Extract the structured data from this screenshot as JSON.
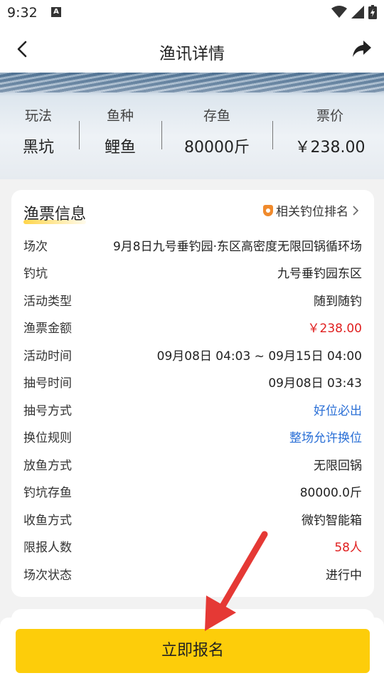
{
  "status_bar": {
    "time": "9:32",
    "a_icon": "A"
  },
  "nav": {
    "title": "渔讯详情"
  },
  "hero": {
    "stats": [
      {
        "label": "玩法",
        "value": "黑坑"
      },
      {
        "label": "鱼种",
        "value": "鲤鱼"
      },
      {
        "label": "存鱼",
        "value": "80000斤"
      },
      {
        "label": "票价",
        "value": "￥238.00"
      }
    ]
  },
  "card": {
    "title": "渔票信息",
    "rank_link": "相关钓位排名",
    "rows": [
      {
        "label": "场次",
        "value": "9月8日九号垂钓园·东区高密度无限回锅循环场"
      },
      {
        "label": "钓坑",
        "value": "九号垂钓园东区"
      },
      {
        "label": "活动类型",
        "value": "随到随钓"
      },
      {
        "label": "渔票金额",
        "value": "￥238.00",
        "color": "red"
      },
      {
        "label": "活动时间",
        "value": "09月08日 04:03 ~ 09月15日 04:00"
      },
      {
        "label": "抽号时间",
        "value": "09月08日 03:43"
      },
      {
        "label": "抽号方式",
        "value": "好位必出",
        "color": "blue"
      },
      {
        "label": "换位规则",
        "value": "整场允许换位",
        "color": "blue"
      },
      {
        "label": "放鱼方式",
        "value": "无限回锅"
      },
      {
        "label": "钓坑存鱼",
        "value": "80000.0斤"
      },
      {
        "label": "收鱼方式",
        "value": "微钓智能箱"
      },
      {
        "label": "限报人数",
        "value": "58人",
        "color": "red"
      },
      {
        "label": "场次状态",
        "value": "进行中"
      }
    ]
  },
  "bottom": {
    "signup_label": "立即报名"
  },
  "colors": {
    "accent": "#fdcd0a",
    "price_red": "#e02020",
    "link_blue": "#2a6fd6"
  }
}
